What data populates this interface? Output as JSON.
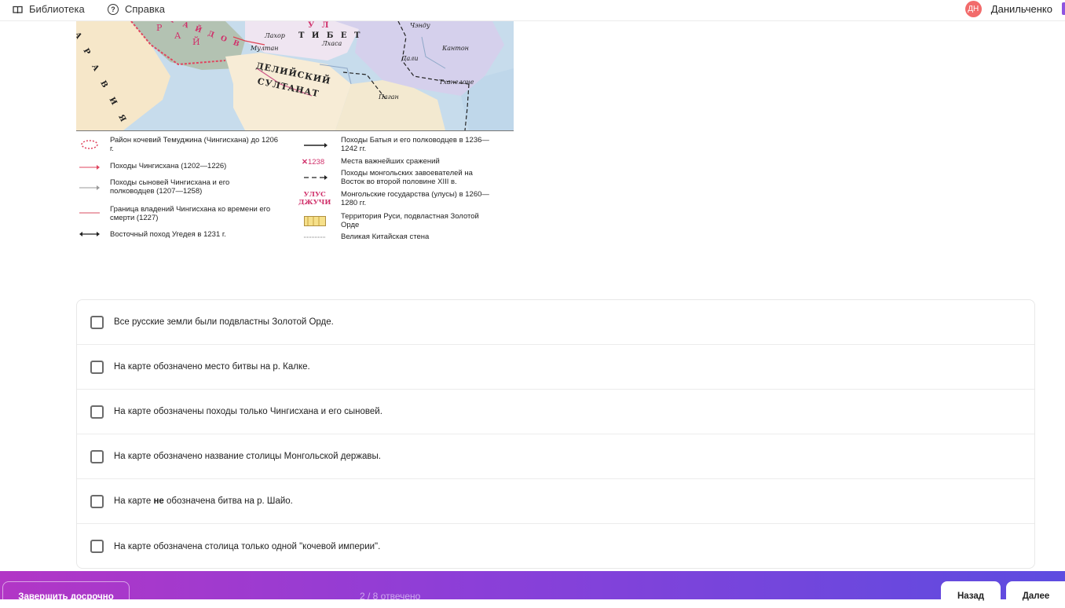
{
  "topbar": {
    "library_label": "Библиотека",
    "help_label": "Справка",
    "avatar_initials": "ДН",
    "user_name": "Данильченко"
  },
  "map": {
    "labels": {
      "arabia": "А Р А В И Я",
      "tibet": "Т И Б Е Т",
      "sultanate_1": "ДЕЛИЙСКИЙ",
      "sultanate_2": "СУЛТАНАТ",
      "lahore": "Лахор",
      "multan": "Мултан",
      "lhasa": "Лхаса",
      "dali": "Дали",
      "pagan": "Паган",
      "chengdu": "Чэнду",
      "canton": "Кантон",
      "tsanelone": "Тханелоне",
      "ulus_fragment": "У Л",
      "khulagu_fragment": "Р А Й Д О В",
      "ulus_usa": "У С"
    },
    "legend": {
      "item1": "Район кочевий Темуджина (Чингисхана) до 1206 г.",
      "item2": "Походы Чингисхана (1202—1226)",
      "item3": "Походы сыновей Чингисхана и его полководцев (1207—1258)",
      "item4": "Граница владений Чингисхана ко времени его смерти (1227)",
      "item5": "Восточный поход Угедея в 1231 г.",
      "item6": "Походы Батыя и его полководцев в 1236—1242 гг.",
      "item7": "Места важнейших сражений",
      "item7_symbol": "1238",
      "item8": "Походы монгольских завоевателей на Восток во второй половине XIII в.",
      "item9": "Монгольские государства (улусы) в 1260—1280 гг.",
      "item9_symbol_1": "УЛУС",
      "item9_symbol_2": "ДЖУЧИ",
      "item10": "Территория Руси, подвластная Золотой Орде",
      "item11": "Великая Китайская стена"
    }
  },
  "options": [
    {
      "text": "Все русские земли были подвластны Золотой Орде."
    },
    {
      "text": "На карте обозначено место битвы на р. Калке."
    },
    {
      "text": "На карте обозначены походы только Чингисхана и его сыновей."
    },
    {
      "text": "На карте обозначено название столицы Монгольской державы."
    },
    {
      "text_before": "На карте ",
      "text_bold": "не",
      "text_after": " обозначена битва на р. Шайо."
    },
    {
      "text": "На карте обозначена столица только одной \"кочевой империи\"."
    }
  ],
  "bottom": {
    "finish_label": "Завершить досрочно",
    "progress_text": "2 / 8 отвечено",
    "back_label": "Назад",
    "next_label": "Далее"
  },
  "colors": {
    "avatar": "#f26b6b",
    "gradient_start": "#b236c6",
    "gradient_end": "#5d4ce0"
  }
}
